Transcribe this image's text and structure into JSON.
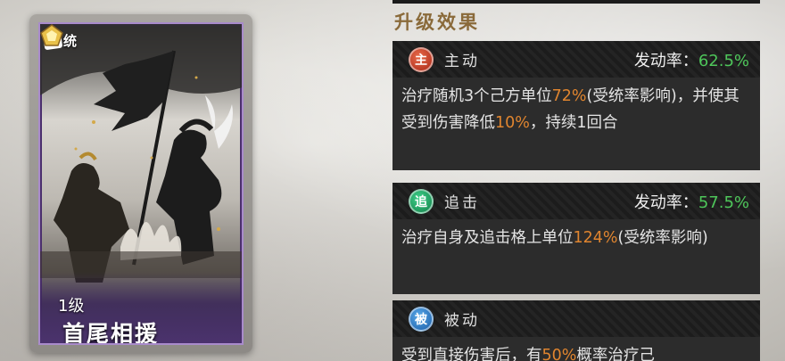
{
  "card": {
    "tier_label": "统",
    "level": "1级",
    "name": "首尾相援"
  },
  "panel": {
    "section_title": "升级效果",
    "skills": [
      {
        "icon_char": "主",
        "icon_name": "active-skill-icon",
        "icon_color": "#c9341f",
        "type": "主动",
        "rate_label": "发动率：",
        "rate_value": "62.5%",
        "desc_segments": [
          {
            "text": "治疗随机3个己方单位",
            "hl": false
          },
          {
            "text": "72%",
            "hl": true
          },
          {
            "text": "(受统率影响)，并使其受到伤害降低",
            "hl": false
          },
          {
            "text": "10%",
            "hl": true
          },
          {
            "text": "，持续1回合",
            "hl": false
          }
        ]
      },
      {
        "icon_char": "追",
        "icon_name": "pursuit-skill-icon",
        "icon_color": "#1d9a5a",
        "type": "追击",
        "rate_label": "发动率：",
        "rate_value": "57.5%",
        "desc_segments": [
          {
            "text": "治疗自身及追击格上单位",
            "hl": false
          },
          {
            "text": "124%",
            "hl": true
          },
          {
            "text": "(受统率影响)",
            "hl": false
          }
        ]
      },
      {
        "icon_char": "被",
        "icon_name": "passive-skill-icon",
        "icon_color": "#2a74c0",
        "type": "被动",
        "desc_segments": [
          {
            "text": "受到直接伤害后，有",
            "hl": false
          },
          {
            "text": "50%",
            "hl": true
          },
          {
            "text": "概率治疗己",
            "hl": false
          }
        ]
      }
    ]
  },
  "colors": {
    "highlight": "#e0852f",
    "rate_green": "#4ec65a",
    "title_gold": "#8a6a3a",
    "card_frame_purple": "#a98bcb"
  }
}
